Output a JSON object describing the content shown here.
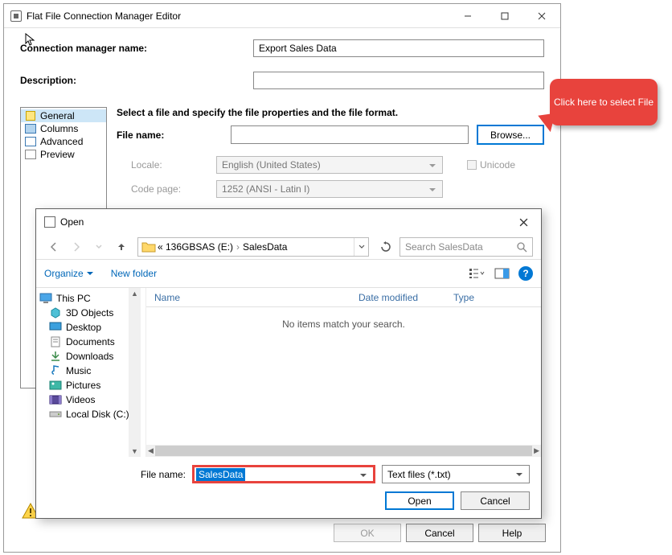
{
  "editor": {
    "title": "Flat File Connection Manager Editor",
    "conn_label": "Connection manager name:",
    "conn_value": "Export Sales Data",
    "desc_label": "Description:",
    "desc_value": "",
    "sidebar": {
      "general": "General",
      "columns": "Columns",
      "advanced": "Advanced",
      "preview": "Preview"
    },
    "instruction": "Select a file and specify the file properties and the file format.",
    "file_label": "File name:",
    "file_value": "",
    "browse": "Browse...",
    "locale_label": "Locale:",
    "locale_value": "English (United States)",
    "unicode_label": "Unicode",
    "codepage_label": "Code page:",
    "codepage_value": "1252  (ANSI - Latin I)",
    "ok": "OK",
    "cancel": "Cancel",
    "help": "Help"
  },
  "callout": {
    "text": "Click here to select File"
  },
  "dialog": {
    "title": "Open",
    "breadcrumb": {
      "root": "«  136GBSAS (E:)",
      "sep": "›",
      "leaf": "SalesData"
    },
    "search_placeholder": "Search SalesData",
    "organize": "Organize",
    "new_folder": "New folder",
    "columns": {
      "name": "Name",
      "date": "Date modified",
      "type": "Type"
    },
    "empty": "No items match your search.",
    "tree": {
      "this_pc": "This PC",
      "objects3d": "3D Objects",
      "desktop": "Desktop",
      "documents": "Documents",
      "downloads": "Downloads",
      "music": "Music",
      "pictures": "Pictures",
      "videos": "Videos",
      "local_disk": "Local Disk (C:)"
    },
    "file_name_label": "File name:",
    "file_name_value": "SalesData",
    "filter": "Text files (*.txt)",
    "open": "Open",
    "cancel": "Cancel"
  }
}
